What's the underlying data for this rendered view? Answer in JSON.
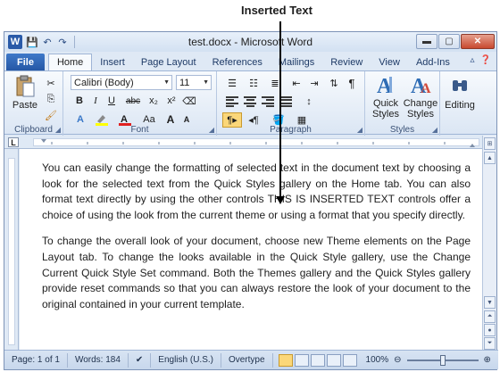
{
  "callout": {
    "label": "Inserted Text"
  },
  "window": {
    "title": "test.docx - Microsoft Word",
    "controls": {
      "minimize": "▬",
      "maximize": "▢",
      "close": "✕"
    }
  },
  "quick_access": {
    "word_logo": "W",
    "save": "💾",
    "undo": "↶",
    "redo": "↷"
  },
  "tabs": [
    {
      "label": "File"
    },
    {
      "label": "Home"
    },
    {
      "label": "Insert"
    },
    {
      "label": "Page Layout"
    },
    {
      "label": "References"
    },
    {
      "label": "Mailings"
    },
    {
      "label": "Review"
    },
    {
      "label": "View"
    },
    {
      "label": "Add-Ins"
    }
  ],
  "ribbon": {
    "clipboard": {
      "label": "Clipboard",
      "paste": "Paste"
    },
    "font": {
      "label": "Font",
      "font_name": "Calibri (Body)",
      "font_size": "11",
      "bold": "B",
      "italic": "I",
      "underline": "U",
      "strikethrough": "abc",
      "subscript": "x₂",
      "superscript": "x²",
      "grow": "A",
      "shrink": "A",
      "case": "Aa",
      "clear": "A"
    },
    "paragraph": {
      "label": "Paragraph",
      "pilcrow": "¶"
    },
    "styles": {
      "label": "Styles",
      "quick_styles": "Quick Styles",
      "change_styles": "Change Styles"
    },
    "editing": {
      "label": "Editing"
    }
  },
  "ruler": {
    "tab_marker": "L"
  },
  "document": {
    "paragraphs": [
      "You can easily change the formatting of selected text in the document text by choosing a look for the selected text from the Quick Styles gallery on the Home tab. You can also format text directly by using the other controls THIS IS INSERTED TEXT controls offer a choice of using the look from the current theme or using a format that you specify directly.",
      "To change the overall look of your document, choose new Theme elements on the Page Layout tab. To change the looks available in the Quick Style gallery, use the Change Current Quick Style Set command. Both the Themes gallery and the Quick Styles gallery provide reset commands so that you can always restore the look of your document to the original contained in your current template."
    ]
  },
  "statusbar": {
    "page": "Page: 1 of 1",
    "words": "Words: 184",
    "language": "English (U.S.)",
    "mode": "Overtype",
    "zoom": "100%",
    "zoom_level_percent": 100
  },
  "colors": {
    "file_tab": "#2557a5",
    "ribbon_bg": "#dbe6f4",
    "active_view": "#fbd779"
  }
}
